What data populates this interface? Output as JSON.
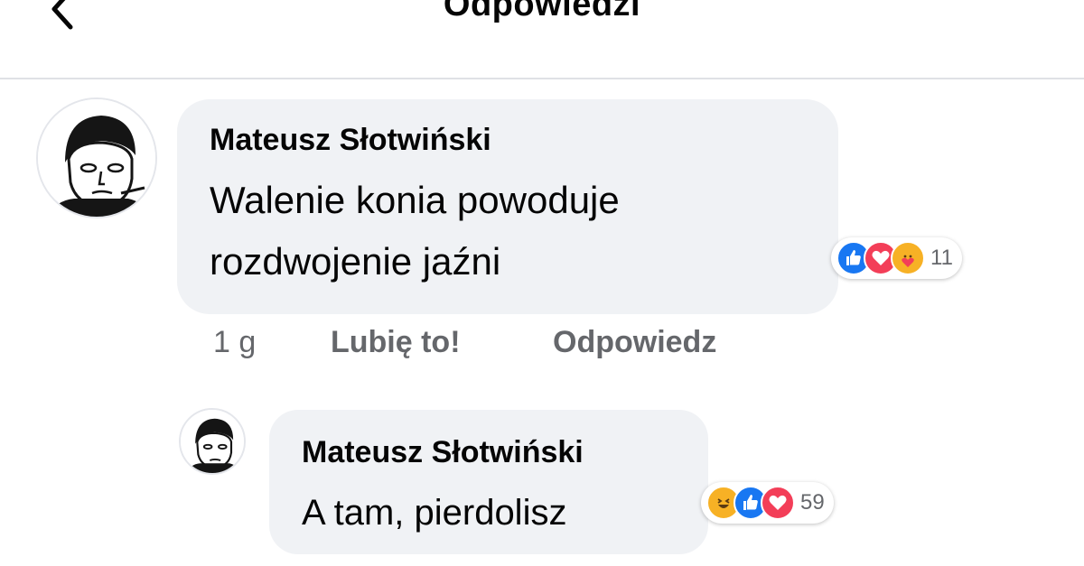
{
  "header": {
    "title": "Odpowiedzi",
    "back_icon": "chevron-left-icon"
  },
  "comment": {
    "author": "Mateusz Słotwiński",
    "text_line1": "Walenie konia powoduje",
    "text_line2": "rozdwojenie jaźni",
    "reactions": [
      "like-icon",
      "love-icon",
      "care-icon"
    ],
    "reaction_count": "11",
    "time": "1 g",
    "like_label": "Lubię to!",
    "reply_label": "Odpowiedz"
  },
  "reply": {
    "author": "Mateusz Słotwiński",
    "text": "A tam, pierdolisz",
    "reactions": [
      "haha-icon",
      "like-icon",
      "love-icon"
    ],
    "reaction_count": "59"
  },
  "colors": {
    "bubble": "#f0f2f5",
    "meta_text": "#65676b",
    "like": "#1877f2",
    "love": "#f33e58",
    "care": "#f7b125"
  }
}
